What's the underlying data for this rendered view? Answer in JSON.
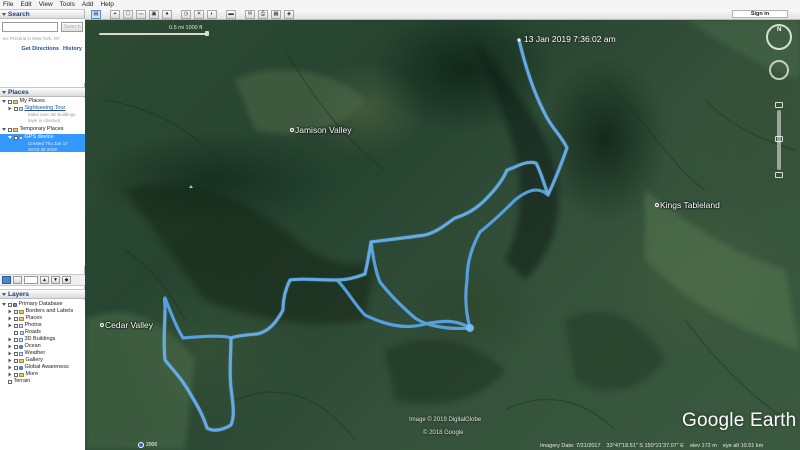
{
  "menu": [
    "File",
    "Edit",
    "View",
    "Tools",
    "Add",
    "Help"
  ],
  "search": {
    "title": "Search",
    "placeholder": "",
    "button_label": "Search",
    "hint": "ex: Pizzeria in New York, NY",
    "links": [
      "Get Directions",
      "History"
    ]
  },
  "places": {
    "title": "Places",
    "my_places": "My Places",
    "sightseeing_tour": "Sightseeing Tour",
    "sightseeing_sub_1": "Make sure 3D Buildings",
    "sightseeing_sub_2": "layer is checked",
    "temporary_places": "Temporary Places",
    "gps_device": "GPS device",
    "gps_sub_1": "Created Thu Jan 17",
    "gps_sub_2": "20:52:40 2019"
  },
  "layers": {
    "title": "Layers",
    "items": [
      "Primary Database",
      "Borders and Labels",
      "Places",
      "Photos",
      "Roads",
      "3D Buildings",
      "Ocean",
      "Weather",
      "Gallery",
      "Global Awareness",
      "More",
      "Terrain"
    ]
  },
  "toolbar": {
    "sign_in": "Sign in"
  },
  "map": {
    "scale_text": "0.5 mi 1000 ft",
    "timestamp": "13 Jan 2019 7:36:02 am",
    "labels": {
      "jamison": "Jamison Valley",
      "kings": "Kings Tableland",
      "cedar": "Cedar Valley"
    },
    "copyright_1": "Image © 2019 DigitalGlobe",
    "copyright_2": "© 2018 Google",
    "logo": "Google Earth",
    "timeline_year": "2006",
    "status": {
      "imagery_date": "Imagery Date: 7/21/2017",
      "coords": "33°47'18.51\" S  150°21'37.07\" E",
      "elev": "elev   172 m",
      "eye_alt": "eye alt  10.51 km"
    },
    "track_color": "#5aaaf0"
  }
}
